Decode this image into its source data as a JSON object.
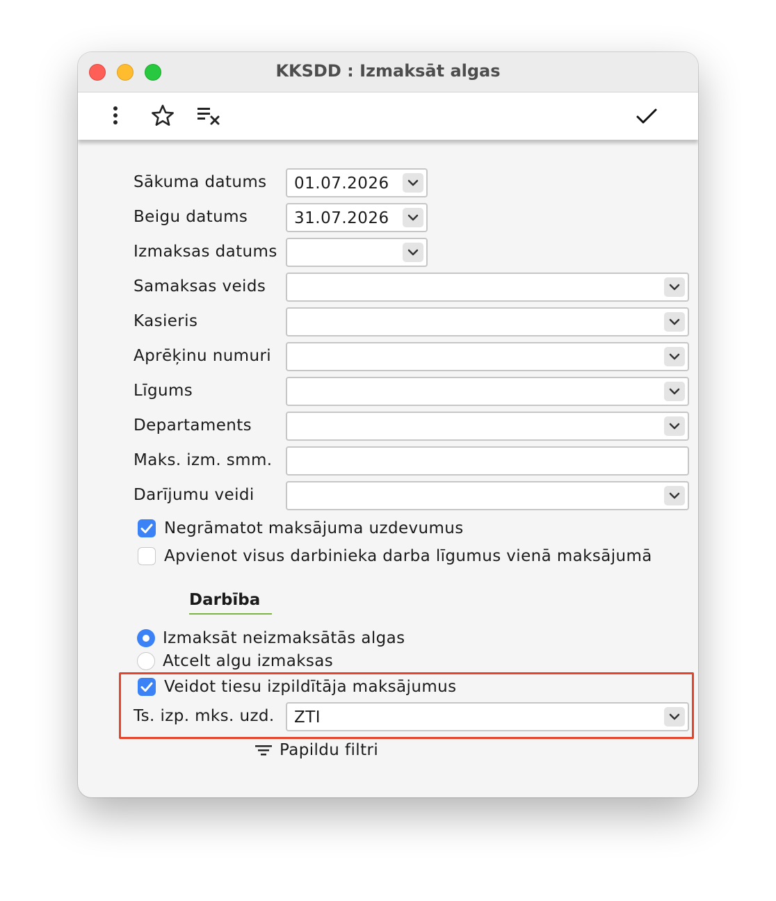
{
  "window": {
    "title": "KKSDD : Izmaksāt algas"
  },
  "toolbar": {
    "menu_icon": "more-vertical-icon",
    "favorite_icon": "star-icon",
    "clear_icon": "clear-filter-icon",
    "confirm_icon": "checkmark-icon"
  },
  "form": {
    "start_date": {
      "label": "Sākuma datums",
      "value": "01.07.2026"
    },
    "end_date": {
      "label": "Beigu datums",
      "value": "31.07.2026"
    },
    "payout_date": {
      "label": "Izmaksas datums",
      "value": ""
    },
    "payment_type": {
      "label": "Samaksas veids",
      "value": ""
    },
    "cashier": {
      "label": "Kasieris",
      "value": ""
    },
    "calc_numbers": {
      "label": "Aprēķinu numuri",
      "value": ""
    },
    "contract": {
      "label": "Līgums",
      "value": ""
    },
    "department": {
      "label": "Departaments",
      "value": ""
    },
    "max_amount": {
      "label": "Maks. izm. smm.",
      "value": ""
    },
    "transaction_types": {
      "label": "Darījumu veidi",
      "value": ""
    },
    "no_booking": {
      "label": "Negrāmatot maksājuma uzdevumus",
      "checked": true
    },
    "merge_contracts": {
      "label": "Apvienot visus darbinieka darba līgumus vienā maksājumā",
      "checked": false
    }
  },
  "action": {
    "title": "Darbība",
    "options": [
      {
        "label": "Izmaksāt neizmaksātās algas",
        "selected": true
      },
      {
        "label": "Atcelt algu izmaksas",
        "selected": false
      }
    ]
  },
  "bailiff": {
    "create_payments": {
      "label": "Veidot tiesu izpildītāja maksājumus",
      "checked": true
    },
    "order": {
      "label": "Ts. izp. mks. uzd.",
      "value": "ZTI"
    }
  },
  "extra_filters": {
    "label": "Papildu filtri",
    "icon": "filter-icon"
  },
  "colors": {
    "accent": "#3b82f6",
    "highlight_border": "#e5442b",
    "section_underline": "#7cb342"
  }
}
